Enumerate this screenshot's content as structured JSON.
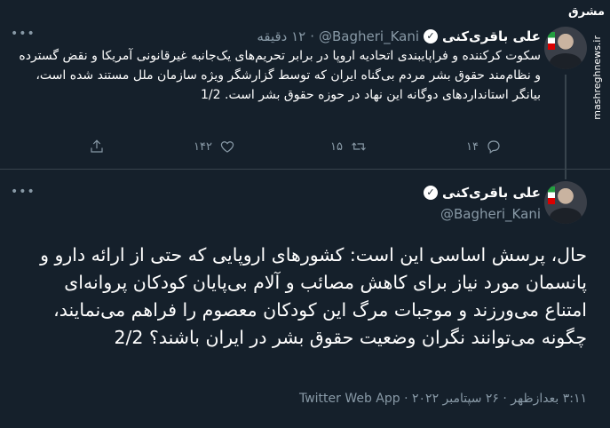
{
  "tweet1": {
    "name": "علی باقری‌کنی",
    "handle": "@Bagheri_Kani",
    "dot": "·",
    "time": "۱۲ دقیقه",
    "text": "سکوت کرکننده و فراپایبندی اتحادیه اروپا در برابر تحریم‌های یک‌جانبه غیرقانونی آمریکا و نقض گسترده و نظام‌مند حقوق بشر مردم بی‌گناه ایران که توسط گزارشگر ویژه سازمان ملل مستند شده است، بیانگر استانداردهای دوگانه این نهاد در حوزه حقوق بشر است. 1/2",
    "reply_count": "۱۴",
    "retweet_count": "۱۵",
    "like_count": "۱۴۲"
  },
  "tweet2": {
    "name": "علی باقری‌کنی",
    "handle": "@Bagheri_Kani",
    "text": "حال، پرسش اساسی این است: کشورهای اروپایی که حتی از ارائه دارو و پانسمان مورد نیاز برای کاهش مصائب و آلام بی‌پایان کودکان پروانه‌ای امتناع می‌ورزند و موجبات مرگ این کودکان معصوم را فراهم می‌نمایند، چگونه می‌توانند نگران وضعیت حقوق بشر در ایران باشند؟ 2/2",
    "meta": "۳:۱۱ بعدازظهر · ۲۶ سپتامبر ۲۰۲۲ · Twitter Web App"
  },
  "watermark": {
    "logo": "مشرق",
    "url": "mashreghnews.ir"
  },
  "icons": {
    "more": "•••",
    "verified": "✓",
    "reply": "reply-icon",
    "retweet": "retweet-icon",
    "like": "heart-icon",
    "share": "share-icon"
  },
  "colors": {
    "background": "#15202b",
    "muted": "#8899a6",
    "divider": "#38444d"
  }
}
